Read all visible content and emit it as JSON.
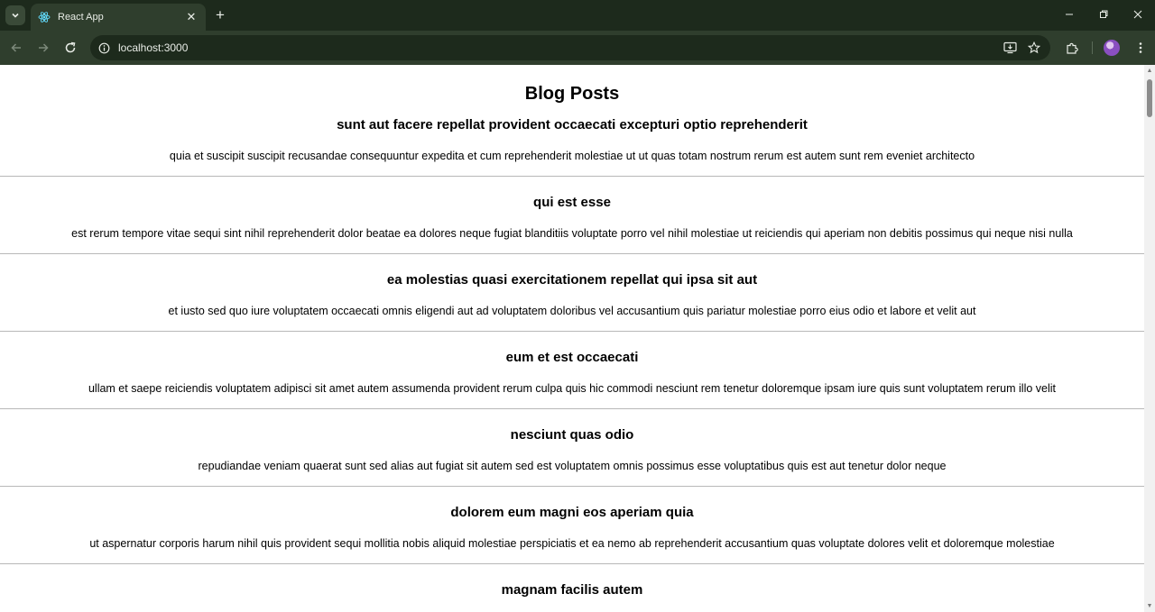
{
  "browser": {
    "tab_title": "React App",
    "url": "localhost:3000",
    "new_tab_label": "+",
    "close_tab_label": "✕"
  },
  "icons": {
    "tab_search": "chevron-down-icon",
    "favicon": "react-logo-icon",
    "back": "arrow-left-icon",
    "forward": "arrow-right-icon",
    "reload": "reload-icon",
    "site_info": "info-icon",
    "install": "install-app-icon",
    "bookmark": "star-icon",
    "extensions": "puzzle-icon",
    "profile": "avatar-icon",
    "menu": "kebab-menu-icon",
    "minimize": "minimize-icon",
    "restore": "restore-icon",
    "close_window": "close-icon"
  },
  "colors": {
    "chrome_dark": "#1d2a1c",
    "chrome_toolbar": "#2f3e2d",
    "divider": "#b8b8b8"
  },
  "page": {
    "heading": "Blog Posts",
    "posts": [
      {
        "title": "sunt aut facere repellat provident occaecati excepturi optio reprehenderit",
        "body": "quia et suscipit suscipit recusandae consequuntur expedita et cum reprehenderit molestiae ut ut quas totam nostrum rerum est autem sunt rem eveniet architecto"
      },
      {
        "title": "qui est esse",
        "body": "est rerum tempore vitae sequi sint nihil reprehenderit dolor beatae ea dolores neque fugiat blanditiis voluptate porro vel nihil molestiae ut reiciendis qui aperiam non debitis possimus qui neque nisi nulla"
      },
      {
        "title": "ea molestias quasi exercitationem repellat qui ipsa sit aut",
        "body": "et iusto sed quo iure voluptatem occaecati omnis eligendi aut ad voluptatem doloribus vel accusantium quis pariatur molestiae porro eius odio et labore et velit aut"
      },
      {
        "title": "eum et est occaecati",
        "body": "ullam et saepe reiciendis voluptatem adipisci sit amet autem assumenda provident rerum culpa quis hic commodi nesciunt rem tenetur doloremque ipsam iure quis sunt voluptatem rerum illo velit"
      },
      {
        "title": "nesciunt quas odio",
        "body": "repudiandae veniam quaerat sunt sed alias aut fugiat sit autem sed est voluptatem omnis possimus esse voluptatibus quis est aut tenetur dolor neque"
      },
      {
        "title": "dolorem eum magni eos aperiam quia",
        "body": "ut aspernatur corporis harum nihil quis provident sequi mollitia nobis aliquid molestiae perspiciatis et ea nemo ab reprehenderit accusantium quas voluptate dolores velit et doloremque molestiae"
      },
      {
        "title": "magnam facilis autem",
        "body": ""
      }
    ]
  }
}
